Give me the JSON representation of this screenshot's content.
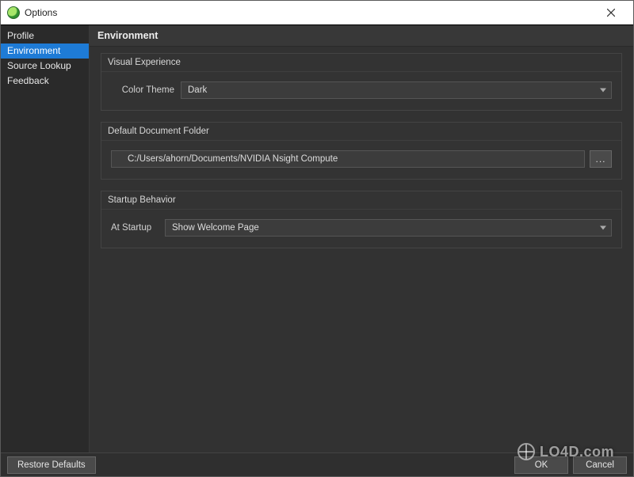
{
  "window": {
    "title": "Options"
  },
  "sidebar": {
    "items": [
      {
        "label": "Profile",
        "selected": false
      },
      {
        "label": "Environment",
        "selected": true
      },
      {
        "label": "Source Lookup",
        "selected": false
      },
      {
        "label": "Feedback",
        "selected": false
      }
    ]
  },
  "main": {
    "header": "Environment",
    "visual_experience": {
      "group_title": "Visual Experience",
      "color_theme_label": "Color Theme",
      "color_theme_value": "Dark"
    },
    "document_folder": {
      "group_title": "Default Document Folder",
      "path": "C:/Users/ahorn/Documents/NVIDIA Nsight Compute",
      "browse_label": "..."
    },
    "startup": {
      "group_title": "Startup Behavior",
      "at_startup_label": "At Startup",
      "at_startup_value": "Show Welcome Page"
    }
  },
  "footer": {
    "restore_defaults": "Restore Defaults",
    "ok": "OK",
    "cancel": "Cancel"
  },
  "watermark": "LO4D.com"
}
